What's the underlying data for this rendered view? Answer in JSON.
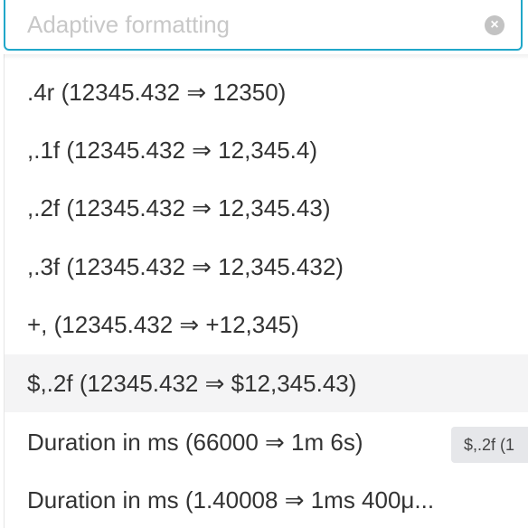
{
  "search": {
    "placeholder": "Adaptive formatting",
    "value": ""
  },
  "menu": {
    "options": [
      {
        "label": ".4r (12345.432 ⇒ 12350)"
      },
      {
        "label": ",.1f (12345.432 ⇒ 12,345.4)"
      },
      {
        "label": ",.2f (12345.432 ⇒ 12,345.43)"
      },
      {
        "label": ",.3f (12345.432 ⇒ 12,345.432)"
      },
      {
        "label": "+, (12345.432 ⇒ +12,345)"
      },
      {
        "label": "$,.2f (12345.432 ⇒ $12,345.43)"
      },
      {
        "label": "Duration in ms (66000 ⇒ 1m 6s)"
      },
      {
        "label": "Duration in ms (1.40008 ⇒ 1ms 400μ..."
      }
    ],
    "focused_index": 5
  },
  "tooltip": {
    "text": "$,.2f (1"
  },
  "icons": {
    "clear": "clear-icon"
  },
  "colors": {
    "accent": "#20a7c9",
    "focused_bg": "#f4f4f5"
  }
}
